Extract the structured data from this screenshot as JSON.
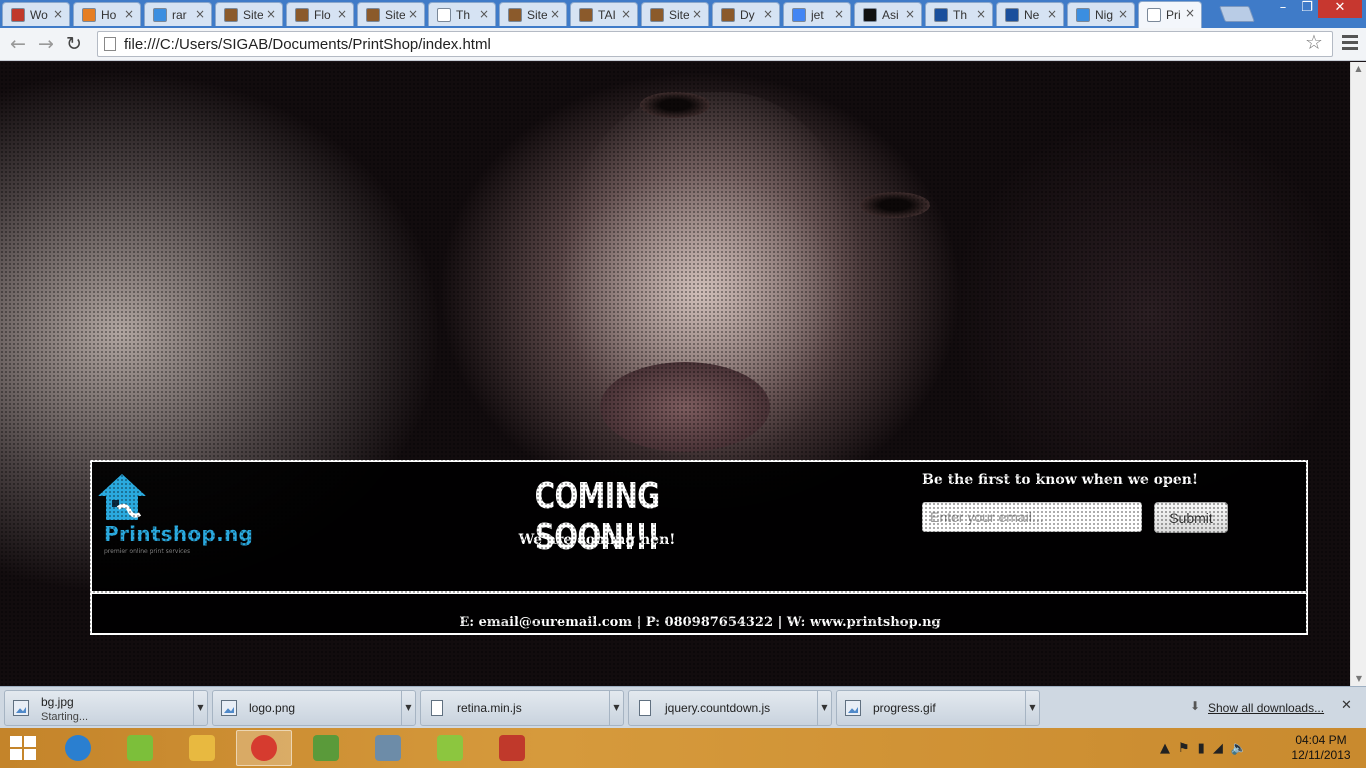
{
  "browser": {
    "tabs": [
      {
        "label": "Wo",
        "color": "#c0392b"
      },
      {
        "label": "Ho",
        "color": "#e67e22"
      },
      {
        "label": "rar",
        "color": "#3b8ee0"
      },
      {
        "label": "Site",
        "color": "#8b5a2b"
      },
      {
        "label": "Flo",
        "color": "#8b5a2b"
      },
      {
        "label": "Site",
        "color": "#8b5a2b"
      },
      {
        "label": "Th",
        "color": "#ffffff"
      },
      {
        "label": "Site",
        "color": "#8b5a2b"
      },
      {
        "label": "TAI",
        "color": "#8b5a2b"
      },
      {
        "label": "Site",
        "color": "#8b5a2b"
      },
      {
        "label": "Dy",
        "color": "#8b5a2b"
      },
      {
        "label": "jet",
        "color": "#4285f4"
      },
      {
        "label": "Asi",
        "color": "#111111"
      },
      {
        "label": "Th",
        "color": "#1a4f9c"
      },
      {
        "label": "Ne",
        "color": "#1a4f9c"
      },
      {
        "label": "Nig",
        "color": "#3b8ee0"
      },
      {
        "label": "Pri",
        "color": "#ffffff"
      }
    ],
    "address": "file:///C:/Users/SIGAB/Documents/PrintShop/index.html"
  },
  "page": {
    "logo_text": "Printshop.ng",
    "logo_tagline": "premier online print services",
    "title": "COMING SOON!!!",
    "subtitle": "We are coming hen!",
    "signup_label": "Be the first to know when we open!",
    "email_placeholder": "Enter your email...",
    "submit_label": "Submit",
    "contact": "E: email@ouremail.com | P: 080987654322 | W: www.printshop.ng"
  },
  "downloads": {
    "items": [
      {
        "name": "bg.jpg",
        "status": "Starting...",
        "icon": "image-file-icon"
      },
      {
        "name": "logo.png",
        "status": "",
        "icon": "image-file-icon"
      },
      {
        "name": "retina.min.js",
        "status": "",
        "icon": "document-file-icon"
      },
      {
        "name": "jquery.countdown.js",
        "status": "",
        "icon": "document-file-icon"
      },
      {
        "name": "progress.gif",
        "status": "",
        "icon": "image-file-icon"
      }
    ],
    "show_all": "Show all downloads..."
  },
  "taskbar": {
    "apps": [
      "internet-explorer-icon",
      "store-icon",
      "file-explorer-icon",
      "chrome-icon",
      "utorrent-icon",
      "stack-app-icon",
      "notepad-plus-icon",
      "flash-icon"
    ],
    "time": "04:04 PM",
    "date": "12/11/2013"
  }
}
